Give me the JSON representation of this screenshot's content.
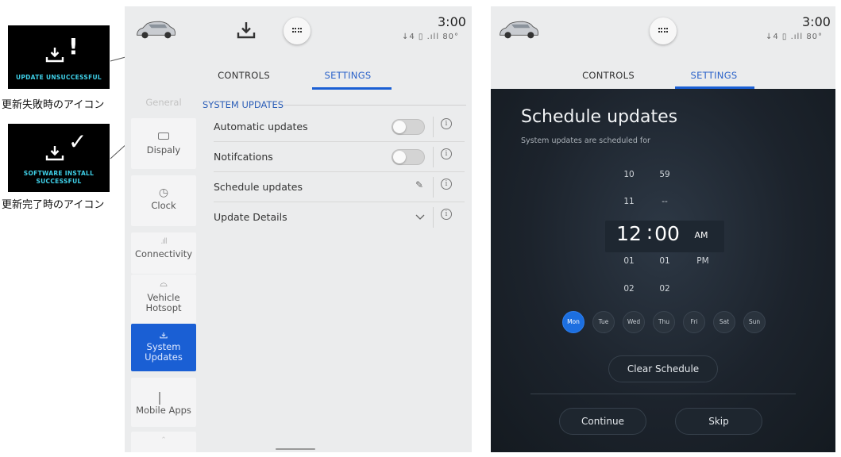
{
  "annotations": {
    "unsuccessful": {
      "icon": "download-exclamation-icon",
      "mark": "!",
      "caption": "UPDATE UNSUCCESSFUL",
      "label": "更新失敗時のアイコン"
    },
    "successful": {
      "icon": "download-check-icon",
      "mark": "✓",
      "caption_line1": "SOFTWARE INSTALL",
      "caption_line2": "SUCCESSFUL",
      "label": "更新完了時のアイコン"
    }
  },
  "panel1": {
    "status": {
      "time": "3:00",
      "temp": "80°",
      "icons": "↓4 ▯ .ıll"
    },
    "tabs": [
      {
        "label": "CONTROLS"
      },
      {
        "label": "SETTINGS",
        "active": true
      }
    ],
    "sidebar": [
      {
        "label": "General",
        "icon": "general-icon"
      },
      {
        "label": "Dispaly",
        "icon": "display-icon"
      },
      {
        "label": "Clock",
        "icon": "clock-icon"
      },
      {
        "label": "Connectivity",
        "icon": "signal-icon"
      },
      {
        "label_line1": "Vehicle",
        "label_line2": "Hotsopt",
        "icon": "hotspot-icon"
      },
      {
        "label_line1": "System",
        "label_line2": "Updates",
        "icon": "download-icon",
        "active": true
      },
      {
        "label": "Mobile Apps",
        "icon": "apps-grid-icon"
      }
    ],
    "section_title": "SYSTEM UPDATES",
    "rows": [
      {
        "label": "Automatic updates",
        "control": "toggle",
        "state": "off"
      },
      {
        "label": "Notifcations",
        "control": "toggle",
        "state": "off"
      },
      {
        "label": "Schedule updates",
        "control": "pencil"
      },
      {
        "label": "Update Details",
        "control": "chevron"
      }
    ],
    "info_glyph": "i"
  },
  "panel2": {
    "status": {
      "time": "3:00",
      "temp": "80°",
      "icons": "↓4 ▯ .ıll"
    },
    "tabs": [
      {
        "label": "CONTROLS"
      },
      {
        "label": "SETTINGS",
        "active": true
      }
    ],
    "title": "Schedule updates",
    "subtitle": "System updates are scheduled for",
    "hours": [
      "10",
      "11",
      "12",
      "01",
      "02"
    ],
    "minutes": [
      "59",
      "--",
      "00",
      "01",
      "02"
    ],
    "colon": ":",
    "am": "AM",
    "pm": "PM",
    "selected_time": "12:00 AM",
    "days": [
      {
        "label": "Mon",
        "selected": true
      },
      {
        "label": "Tue"
      },
      {
        "label": "Wed"
      },
      {
        "label": "Thu"
      },
      {
        "label": "Fri"
      },
      {
        "label": "Sat"
      },
      {
        "label": "Sun"
      }
    ],
    "clear_label": "Clear Schedule",
    "continue_label": "Continue",
    "skip_label": "Skip"
  },
  "colors": {
    "accent": "#1a5fd4",
    "section": "#2d5fb8",
    "day_selected": "#1c6fe0"
  }
}
